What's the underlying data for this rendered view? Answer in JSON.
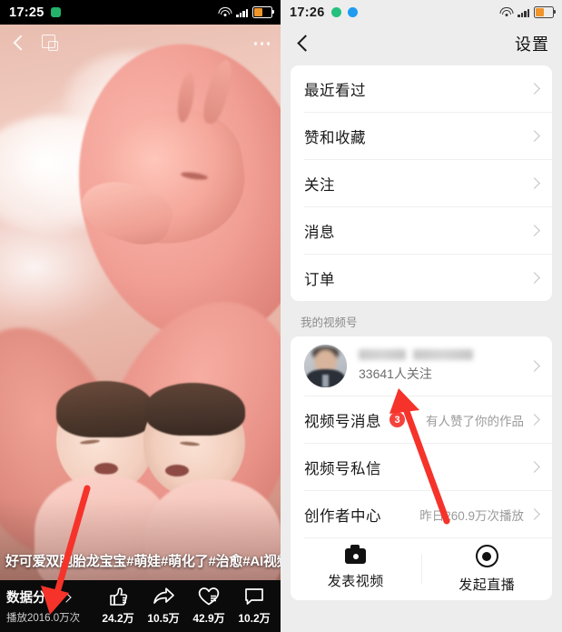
{
  "left_panel": {
    "status_bar": {
      "time": "17:25",
      "icons": [
        "wechat-green-icon",
        "wifi-icon",
        "signal-icon",
        "battery-icon"
      ]
    },
    "top_bar": {
      "back": "back-chevron",
      "multiwindow": "multi-window-icon",
      "more": "more-options-icon"
    },
    "caption": "好可爱双胞胎龙宝宝#萌娃#萌化了#治愈#AI视频",
    "bottom_bar": {
      "data_label": "数据分析",
      "plays": "播放2016.0万次",
      "stats": [
        {
          "icon": "thumbs-up-icon",
          "value": "24.2万"
        },
        {
          "icon": "share-arrow-icon",
          "value": "10.5万"
        },
        {
          "icon": "heart-icon",
          "value": "42.9万"
        },
        {
          "icon": "comment-icon",
          "value": "10.2万"
        }
      ]
    }
  },
  "right_panel": {
    "status_bar": {
      "time": "17:26",
      "icons": [
        "sync-icon",
        "blue-dot-icon",
        "wifi-icon",
        "signal-icon",
        "battery-icon"
      ]
    },
    "nav": {
      "back": "back-chevron",
      "title": "设置"
    },
    "settings_list": [
      {
        "label": "最近看过"
      },
      {
        "label": "赞和收藏"
      },
      {
        "label": "关注"
      },
      {
        "label": "消息"
      },
      {
        "label": "订单"
      }
    ],
    "section_label": "我的视频号",
    "account": {
      "name": "",
      "followers": "33641人关注"
    },
    "channel_rows": [
      {
        "label": "视频号消息",
        "badge": "3",
        "value": "有人赞了你的作品"
      },
      {
        "label": "视频号私信",
        "badge": "",
        "value": ""
      },
      {
        "label": "创作者中心",
        "badge": "",
        "value": "昨日260.9万次播放"
      }
    ],
    "actions": [
      {
        "label": "发表视频",
        "icon": "camera-icon"
      },
      {
        "label": "发起直播",
        "icon": "record-circle-icon"
      }
    ]
  },
  "annotations": {
    "arrow_color": "#f5332a",
    "arrows": [
      {
        "name": "arrow-to-plays",
        "points_to": "播放2016.0万次"
      },
      {
        "name": "arrow-to-followers",
        "points_to": "33641人关注"
      }
    ]
  }
}
